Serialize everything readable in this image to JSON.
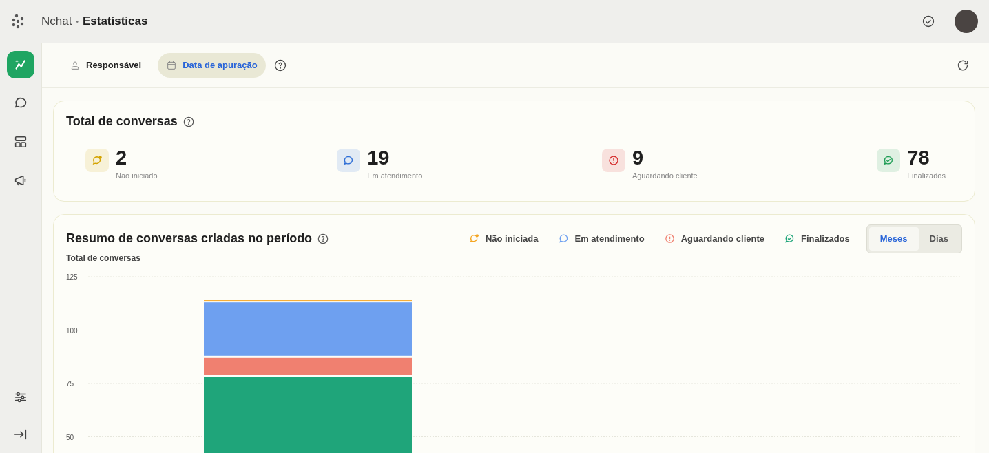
{
  "header": {
    "app": "Nchat",
    "separator": "•",
    "page": "Estatísticas"
  },
  "sidebar": {
    "items": [
      {
        "kind": "stats",
        "selected": true
      },
      {
        "kind": "chat",
        "selected": false
      },
      {
        "kind": "layout",
        "selected": false
      },
      {
        "kind": "megaphone",
        "selected": false
      }
    ],
    "bottom": [
      {
        "kind": "sliders"
      },
      {
        "kind": "collapse"
      }
    ]
  },
  "filters": [
    {
      "label": "Responsável",
      "kind": "person",
      "selected": false
    },
    {
      "label": "Data de apuração",
      "kind": "calendar",
      "selected": true
    }
  ],
  "totals": {
    "title": "Total de conversas",
    "items": [
      {
        "value": "2",
        "label": "Não iniciado",
        "kind": "new",
        "color": "#d4a300"
      },
      {
        "value": "19",
        "label": "Em atendimento",
        "kind": "chat",
        "color": "#2f6fd6"
      },
      {
        "value": "9",
        "label": "Aguardando cliente",
        "kind": "alert",
        "color": "#d62f2f"
      },
      {
        "value": "78",
        "label": "Finalizados",
        "kind": "done",
        "color": "#1f9d55"
      }
    ]
  },
  "summary": {
    "title": "Resumo de conversas criadas no período",
    "legend": [
      {
        "kind": "new"
      },
      {
        "kind": "chat"
      },
      {
        "kind": "alert"
      },
      {
        "kind": "done"
      }
    ],
    "periods": [
      {
        "label": "Meses",
        "selected": true
      },
      {
        "label": "Dias",
        "selected": false
      }
    ],
    "chart_data": {
      "type": "bar",
      "stacked": true,
      "grid": true,
      "ylabel": "Total de conversas",
      "ylim": [
        0,
        125
      ],
      "yticks": [
        50,
        75,
        100,
        125
      ],
      "series": [
        {
          "name": "Não iniciada",
          "color": "#f5a623",
          "values": [
            1
          ]
        },
        {
          "name": "Em atendimento",
          "color": "#6ea0f0",
          "values": [
            26
          ]
        },
        {
          "name": "Aguardando cliente",
          "color": "#f08070",
          "values": [
            9
          ]
        },
        {
          "name": "Finalizados",
          "color": "#1fa57a",
          "values": [
            78
          ]
        }
      ]
    }
  }
}
